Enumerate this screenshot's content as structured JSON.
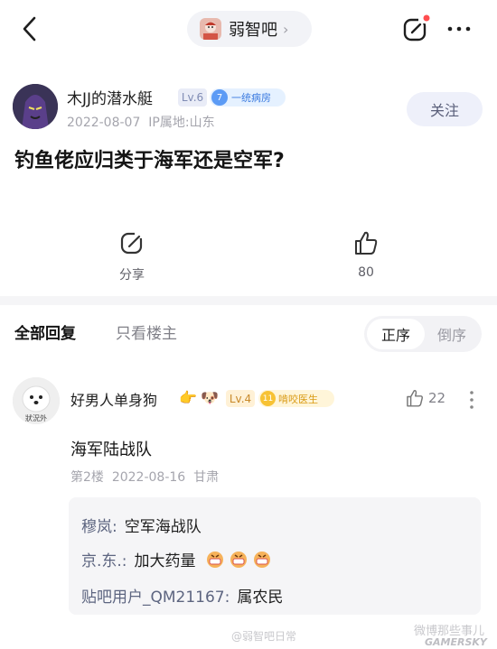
{
  "topbar": {
    "forum_name": "弱智吧",
    "back_icon": "back-arrow-icon",
    "edit_icon": "edit-icon",
    "more_icon": "more-dots-icon",
    "notify_dot_color": "#ff4d4f"
  },
  "post": {
    "author": "木JJ的潜水艇",
    "level": "Lv.6",
    "title_badge_num": "7",
    "title_badge": "一统病房",
    "date": "2022-08-07",
    "ip": "IP属地:山东",
    "follow_label": "关注",
    "title": "钓鱼佬应归类于海军还是空军?",
    "share_label": "分享",
    "like_count": "80"
  },
  "tabs": {
    "all": "全部回复",
    "op_only": "只看楼主",
    "sort_asc": "正序",
    "sort_desc": "倒序"
  },
  "comment": {
    "author": "好男人单身狗",
    "emoji1": "👉",
    "emoji2": "🐶",
    "level": "Lv.4",
    "title_badge_num": "11",
    "title_badge": "啃咬医生",
    "likes": "22",
    "text": "海军陆战队",
    "floor": "第2楼",
    "date": "2022-08-16",
    "location": "甘肃",
    "avatar_caption": "狀況外",
    "replies": [
      {
        "user": "穆岚:",
        "text": "空军海战队"
      },
      {
        "user": "京.东.:",
        "text": "加大药量"
      },
      {
        "user": "贴吧用户_QM21167:",
        "text": "属农民"
      }
    ]
  },
  "watermarks": {
    "left": "@弱智吧日常",
    "right": "微博那些事儿",
    "brand": "GAMERSKY"
  }
}
